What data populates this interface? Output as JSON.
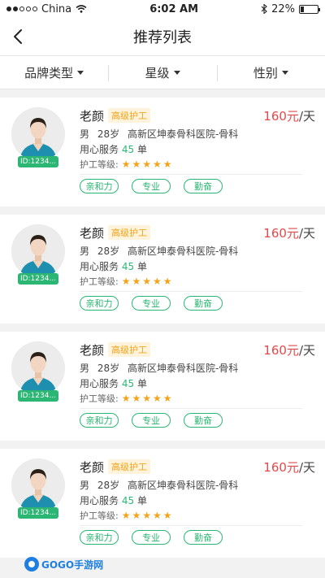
{
  "status_bar": {
    "carrier": "China",
    "time": "6:02 AM",
    "battery": "22%",
    "battery_level": 0.22
  },
  "navbar": {
    "title": "推荐列表"
  },
  "filters": [
    {
      "label": "品牌类型"
    },
    {
      "label": "星级"
    },
    {
      "label": "性别"
    }
  ],
  "caregivers": [
    {
      "id": "ID:1234...",
      "name": "老颜",
      "level": "高级护工",
      "price_num": "160元",
      "price_unit": "/天",
      "gender": "男",
      "age": "28岁",
      "location": "高新区坤泰骨科医院-骨科",
      "service_prefix": "用心服务",
      "service_count": "45",
      "service_suffix": "单",
      "rating_label": "护工等级:",
      "stars": 5,
      "tags": [
        "亲和力",
        "专业",
        "勤奋"
      ]
    },
    {
      "id": "ID:1234...",
      "name": "老颜",
      "level": "高级护工",
      "price_num": "160元",
      "price_unit": "/天",
      "gender": "男",
      "age": "28岁",
      "location": "高新区坤泰骨科医院-骨科",
      "service_prefix": "用心服务",
      "service_count": "45",
      "service_suffix": "单",
      "rating_label": "护工等级:",
      "stars": 5,
      "tags": [
        "亲和力",
        "专业",
        "勤奋"
      ]
    },
    {
      "id": "ID:1234...",
      "name": "老颜",
      "level": "高级护工",
      "price_num": "160元",
      "price_unit": "/天",
      "gender": "男",
      "age": "28岁",
      "location": "高新区坤泰骨科医院-骨科",
      "service_prefix": "用心服务",
      "service_count": "45",
      "service_suffix": "单",
      "rating_label": "护工等级:",
      "stars": 5,
      "tags": [
        "亲和力",
        "专业",
        "勤奋"
      ]
    },
    {
      "id": "ID:1234...",
      "name": "老颜",
      "level": "高级护工",
      "price_num": "160元",
      "price_unit": "/天",
      "gender": "男",
      "age": "28岁",
      "location": "高新区坤泰骨科医院-骨科",
      "service_prefix": "用心服务",
      "service_count": "45",
      "service_suffix": "单",
      "rating_label": "护工等级:",
      "stars": 5,
      "tags": [
        "亲和力",
        "专业",
        "勤奋"
      ]
    }
  ],
  "watermark": {
    "text": "GOGO手游网"
  },
  "colors": {
    "accent_green": "#2bb673",
    "price_red": "#e24a4a",
    "star_orange": "#f5a31a"
  }
}
